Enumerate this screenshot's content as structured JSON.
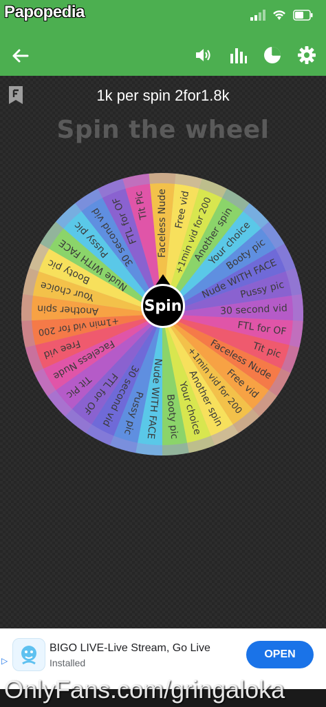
{
  "watermark_top": "Papopedia",
  "watermark_bottom": "OnlyFans.com/gringaloka",
  "appbar": {
    "back_icon": "arrow-left-icon",
    "icons": [
      "volume-icon",
      "bar-chart-icon",
      "pie-chart-icon",
      "gear-icon"
    ]
  },
  "title": "1k per spin 2for1.8k",
  "heading": "Spin the wheel",
  "spin_label": "Spin",
  "wheel": {
    "segments": [
      {
        "label": "Faceless Nude",
        "color": "#f3c14a"
      },
      {
        "label": "Free vid",
        "color": "#f7e05c"
      },
      {
        "label": "+1min vid for 200",
        "color": "#d8e64f"
      },
      {
        "label": "Another spin",
        "color": "#8bd46a"
      },
      {
        "label": "Your choice",
        "color": "#5ac8e8"
      },
      {
        "label": "Booty pic",
        "color": "#5f8fe0"
      },
      {
        "label": "Nude WITH FACE",
        "color": "#6f6ad8"
      },
      {
        "label": "Pussy pic",
        "color": "#8a62d0"
      },
      {
        "label": "30 second vid",
        "color": "#b55bc8"
      },
      {
        "label": "FTL for OF",
        "color": "#e055a8"
      },
      {
        "label": "Tit pic",
        "color": "#ef5a6e"
      },
      {
        "label": "Faceless Nude",
        "color": "#f57a48"
      },
      {
        "label": "Free vid",
        "color": "#f7a244"
      },
      {
        "label": "+1min vid for 200",
        "color": "#f3c14a"
      },
      {
        "label": "Another spin",
        "color": "#f7e05c"
      },
      {
        "label": "Your choice",
        "color": "#d8e64f"
      },
      {
        "label": "Booty pic",
        "color": "#8bd46a"
      },
      {
        "label": "Nude WITH FACE",
        "color": "#5ac8e8"
      },
      {
        "label": "Pussy pic",
        "color": "#5f8fe0"
      },
      {
        "label": "30 second vid",
        "color": "#6f6ad8"
      },
      {
        "label": "FTL for OF",
        "color": "#8a62d0"
      },
      {
        "label": "Tit Pic",
        "color": "#b55bc8"
      },
      {
        "label": "Faceless Nude",
        "color": "#e055a8"
      },
      {
        "label": "Free vid",
        "color": "#ef5a6e"
      },
      {
        "label": "+1min vid for 200",
        "color": "#f57a48"
      },
      {
        "label": "Another spin",
        "color": "#f7a244"
      },
      {
        "label": "Your choice",
        "color": "#f3c14a"
      },
      {
        "label": "Booty pic",
        "color": "#f7e05c"
      },
      {
        "label": "Nude WITH FACE",
        "color": "#8bd46a"
      },
      {
        "label": "Pussy pic",
        "color": "#5ac8e8"
      },
      {
        "label": "30 second vid",
        "color": "#5f8fe0"
      },
      {
        "label": "FTL for OF",
        "color": "#8a62d0"
      },
      {
        "label": "Tit Pic",
        "color": "#e055a8"
      }
    ]
  },
  "ad": {
    "app_name": "BIGO LIVE-Live Stream, Go Live",
    "status": "Installed",
    "button": "OPEN",
    "ad_icon": "adchoices-icon"
  }
}
